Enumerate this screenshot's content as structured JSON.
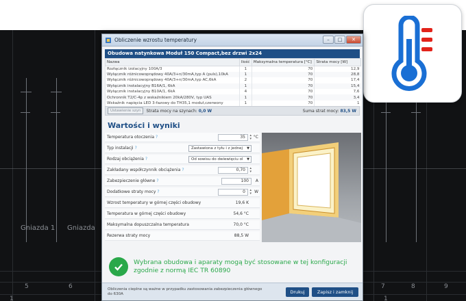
{
  "colors": {
    "accent": "#1f4f86",
    "success": "#2aa84a",
    "thermo_blue": "#1a6fd4",
    "thermo_red": "#e2231a"
  },
  "icons": {
    "tile": "thermometer-icon",
    "result": "check-circle-icon"
  },
  "background": {
    "labels": [
      "Gniazda 1",
      "Gniazda",
      "5",
      "6",
      "7",
      "8",
      "9",
      "1",
      "1"
    ]
  },
  "window": {
    "title": "Obliczenie wzrostu temperatury",
    "buttons": {
      "minimize": "–",
      "maximize": "□",
      "close": "✕"
    }
  },
  "enclosure": {
    "header": "Obudowa natynkowa Moduł 150 Compact,bez drzwi 2x24",
    "columns": [
      "Nazwa",
      "Ilość",
      "Maksymalna temperatura [°C]",
      "Strata mocy [W]"
    ],
    "rows": [
      [
        "Rozłącznik izolacyjny 100A/3",
        "1",
        "70",
        "12,9"
      ],
      [
        "Wyłącznik różnicowoprądowy 40A/3+n/30mA,typ A (puls),10kA",
        "1",
        "70",
        "28,8"
      ],
      [
        "Wyłącznik różnicowoprądowy 40A/3+n/30mA,typ AC,6kA",
        "2",
        "70",
        "17,4"
      ],
      [
        "Wyłącznik instalacyjny B16A/1, 6kA",
        "1",
        "70",
        "15,4"
      ],
      [
        "Wyłącznik instalacyjny B10A/1, 6kA",
        "4",
        "70",
        "7,6"
      ],
      [
        "Ochronnik T2/C-4p z wskaźnikiem 20kA/280V, typ UAS",
        "1",
        "70",
        "3,4"
      ],
      [
        "Wskaźnik napięcia LED 3-fazowy do TH35,1 moduł,czerwony",
        "1",
        "70",
        "1"
      ]
    ],
    "footer": {
      "button": "Ustawienie szyn",
      "busbar_label": "Strata mocy na szynach:",
      "busbar_value": "0,0 W",
      "sum_label": "Suma strat mocy:",
      "sum_value": "83,5 W"
    }
  },
  "results": {
    "title": "Wartości i wyniki",
    "fields": [
      {
        "label": "Temperatura otoczenia",
        "value": "35",
        "unit": "°C",
        "kind": "spin"
      },
      {
        "label": "Typ instalacji",
        "value": "Zastawiona z tyłu i z jednej",
        "kind": "select"
      },
      {
        "label": "Rodzaj obciążenia",
        "value": "Od sowisu do dwiewięciu ol",
        "kind": "select"
      },
      {
        "label": "Zakładany współczynnik obciążenia",
        "value": "0,70",
        "unit": "",
        "kind": "spin"
      },
      {
        "label": "Zabezpieczenie główne",
        "value": "100",
        "unit": "A",
        "kind": "input"
      },
      {
        "label": "Dodatkowe straty mocy",
        "value": "0",
        "unit": "W",
        "kind": "spin"
      },
      {
        "label": "Wzrost temperatury w górnej części obudowy",
        "value": "19,6 K",
        "kind": "readout"
      },
      {
        "label": "Temperatura w górnej części obudowy",
        "value": "54,6 °C",
        "kind": "readout"
      },
      {
        "label": "Maksymalna dopuszczalna temperatura",
        "value": "70,0 °C",
        "kind": "readout"
      },
      {
        "label": "Rezerwa straty mocy",
        "value": "88,5 W",
        "kind": "readout"
      }
    ],
    "message_line1": "Wybrana obudowa i aparaty mogą być stosowane w tej konfiguracji",
    "message_line2": "zgodnie z normą IEC TR 60890"
  },
  "bottom": {
    "note": "Obliczenia cieplne są ważne w przypadku zastosowania zabezpieczenia głównego do 630A",
    "print_label": "Drukuj",
    "save_close_label": "Zapisz i zamknij"
  }
}
